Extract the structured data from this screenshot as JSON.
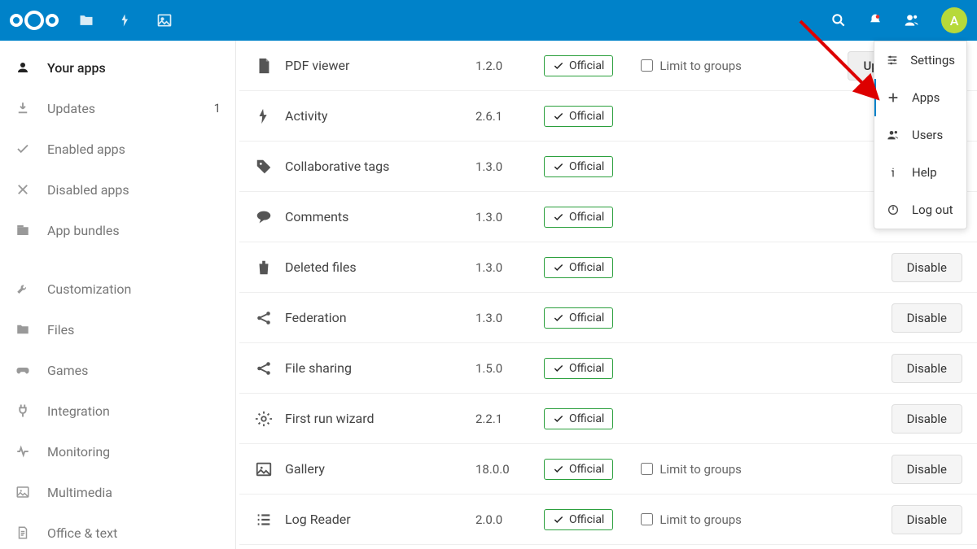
{
  "avatar_letter": "A",
  "sidebar": {
    "items": [
      {
        "icon": "user",
        "label": "Your apps",
        "active": true
      },
      {
        "icon": "download",
        "label": "Updates",
        "badge": "1"
      },
      {
        "icon": "check",
        "label": "Enabled apps"
      },
      {
        "icon": "x",
        "label": "Disabled apps"
      },
      {
        "icon": "bundle",
        "label": "App bundles"
      }
    ],
    "categories": [
      {
        "icon": "wrench",
        "label": "Customization"
      },
      {
        "icon": "folder",
        "label": "Files"
      },
      {
        "icon": "games",
        "label": "Games"
      },
      {
        "icon": "plug",
        "label": "Integration"
      },
      {
        "icon": "pulse",
        "label": "Monitoring"
      },
      {
        "icon": "image",
        "label": "Multimedia"
      },
      {
        "icon": "doc",
        "label": "Office & text"
      }
    ]
  },
  "apps": [
    {
      "icon": "pdf",
      "name": "PDF viewer",
      "version": "1.2.0",
      "badge": "Official",
      "limit": true,
      "action": "Update to 1.2.1",
      "action_kind": "update"
    },
    {
      "icon": "bolt",
      "name": "Activity",
      "version": "2.6.1",
      "badge": "Official",
      "action": ""
    },
    {
      "icon": "tag",
      "name": "Collaborative tags",
      "version": "1.3.0",
      "badge": "Official",
      "action": ""
    },
    {
      "icon": "comment",
      "name": "Comments",
      "version": "1.3.0",
      "badge": "Official",
      "action": ""
    },
    {
      "icon": "trash",
      "name": "Deleted files",
      "version": "1.3.0",
      "badge": "Official",
      "action": "Disable"
    },
    {
      "icon": "share",
      "name": "Federation",
      "version": "1.3.0",
      "badge": "Official",
      "action": "Disable"
    },
    {
      "icon": "share",
      "name": "File sharing",
      "version": "1.5.0",
      "badge": "Official",
      "action": "Disable"
    },
    {
      "icon": "gear",
      "name": "First run wizard",
      "version": "2.2.1",
      "badge": "Official",
      "action": "Disable"
    },
    {
      "icon": "image",
      "name": "Gallery",
      "version": "18.0.0",
      "badge": "Official",
      "limit": true,
      "action": "Disable"
    },
    {
      "icon": "list",
      "name": "Log Reader",
      "version": "2.0.0",
      "badge": "Official",
      "limit": true,
      "action": "Disable"
    }
  ],
  "limit_label": "Limit to groups",
  "dropdown": [
    {
      "icon": "settings",
      "label": "Settings"
    },
    {
      "icon": "plus",
      "label": "Apps",
      "active": true
    },
    {
      "icon": "users",
      "label": "Users"
    },
    {
      "icon": "info",
      "label": "Help"
    },
    {
      "icon": "power",
      "label": "Log out"
    }
  ]
}
